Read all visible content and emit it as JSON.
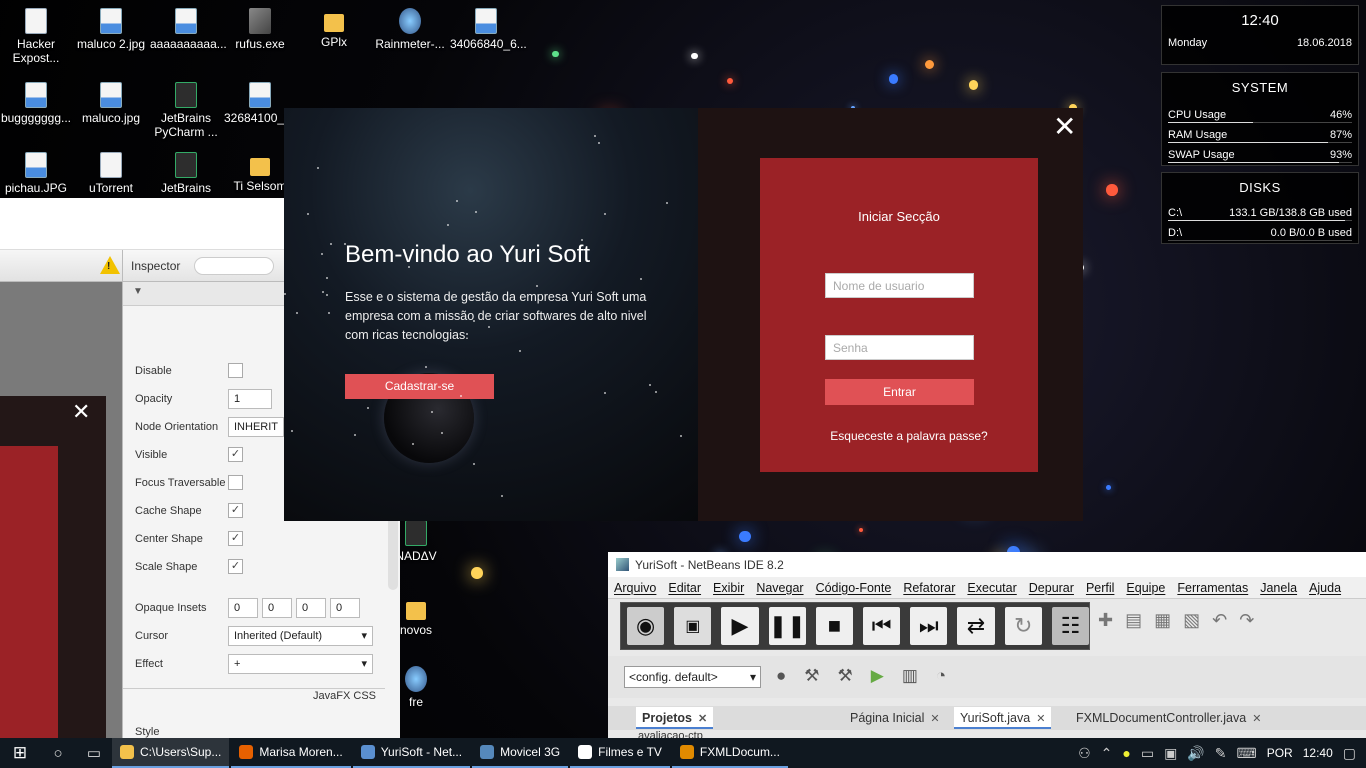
{
  "desktop": {
    "icons": [
      {
        "label": "Hacker Expost...",
        "icon": "pdf-file-icon"
      },
      {
        "label": "maluco 2.jpg",
        "icon": "image-file-icon"
      },
      {
        "label": "aaaaaaaaaa...",
        "icon": "image-file-icon"
      },
      {
        "label": "rufus.exe",
        "icon": "usb-drive-icon"
      },
      {
        "label": "GPlx",
        "icon": "folder-icon"
      },
      {
        "label": "Rainmeter-...",
        "icon": "rainmeter-icon"
      },
      {
        "label": "34066840_6...",
        "icon": "image-file-icon"
      },
      {
        "label": "buggggggg...",
        "icon": "image-file-icon"
      },
      {
        "label": "maluco.jpg",
        "icon": "image-file-icon"
      },
      {
        "label": "JetBrains PyCharm ...",
        "icon": "pycharm-icon"
      },
      {
        "label": "32684100_1...",
        "icon": "image-file-icon"
      },
      {
        "label": "pichau.JPG",
        "icon": "image-file-icon"
      },
      {
        "label": "uTorrent",
        "icon": "file-icon"
      },
      {
        "label": "JetBrains",
        "icon": "pycharm-icon"
      },
      {
        "label": "Ti Selsom",
        "icon": "folder-icon"
      },
      {
        "label": "NADΔV",
        "icon": "app-icon"
      },
      {
        "label": "novos",
        "icon": "folder-icon"
      },
      {
        "label": "fre",
        "icon": "firefox-icon"
      }
    ]
  },
  "widgets": {
    "clock": {
      "time": "12:40",
      "day": "Monday",
      "date": "18.06.2018"
    },
    "system": {
      "title": "SYSTEM",
      "rows": [
        {
          "label": "CPU Usage",
          "value": "46%",
          "fill": 0.46
        },
        {
          "label": "RAM Usage",
          "value": "87%",
          "fill": 0.87
        },
        {
          "label": "SWAP Usage",
          "value": "93%",
          "fill": 0.93
        }
      ]
    },
    "disks": {
      "title": "DISKS",
      "rows": [
        {
          "label": "C:\\",
          "value": "133.1 GB/138.8 GB used",
          "fill": 0.96
        },
        {
          "label": "D:\\",
          "value": "0.0 B/0.0 B used",
          "fill": 0.0
        }
      ]
    }
  },
  "scene_builder": {
    "inspector_label": "Inspector",
    "warning_symbol": "!",
    "properties": [
      {
        "label": "Disable",
        "type": "checkbox",
        "checked": false
      },
      {
        "label": "Opacity",
        "type": "field",
        "value": "1"
      },
      {
        "label": "Node Orientation",
        "type": "field",
        "value": "INHERIT"
      },
      {
        "label": "Visible",
        "type": "checkbox",
        "checked": true
      },
      {
        "label": "Focus Traversable",
        "type": "checkbox",
        "checked": false
      },
      {
        "label": "Cache Shape",
        "type": "checkbox",
        "checked": true
      },
      {
        "label": "Center Shape",
        "type": "checkbox",
        "checked": true
      },
      {
        "label": "Scale Shape",
        "type": "checkbox",
        "checked": true
      },
      {
        "label": "Opaque Insets",
        "type": "insets",
        "values": [
          "0",
          "0",
          "0",
          "0"
        ]
      },
      {
        "label": "Cursor",
        "type": "select",
        "value": "Inherited (Default)"
      },
      {
        "label": "Effect",
        "type": "select",
        "value": "+"
      }
    ],
    "css_label": "JavaFX CSS",
    "style_label": "Style"
  },
  "login_dialog": {
    "welcome_title": "Bem-vindo ao Yuri Soft",
    "description": "Esse e o sistema de gestão da empresa Yuri Soft uma empresa com a missão de criar softwares de alto nivel com ricas tecnologias.",
    "signup_label": "Cadastrar-se",
    "close_symbol": "✕",
    "login_title": "Iniciar Secção",
    "username_placeholder": "Nome de usuario",
    "password_placeholder": "Senha",
    "login_button": "Entrar",
    "forgot_link": "Esqueceste a palavra passe?"
  },
  "netbeans": {
    "title": "YuriSoft - NetBeans IDE 8.2",
    "menu": [
      "Arquivo",
      "Editar",
      "Exibir",
      "Navegar",
      "Código-Fonte",
      "Refatorar",
      "Executar",
      "Depurar",
      "Perfil",
      "Equipe",
      "Ferramentas",
      "Janela",
      "Ajuda"
    ],
    "config": "<config. default>",
    "projects_tab": "Projetos",
    "project_item": "avaliacao-ctp",
    "editor_tabs": [
      "Página Inicial",
      "YuriSoft.java",
      "FXMLDocumentController.java"
    ]
  },
  "taskbar": {
    "apps": [
      {
        "label": "C:\\Users\\Sup...",
        "color": "#f3c14b"
      },
      {
        "label": "Marisa Moren...",
        "color": "#e66000"
      },
      {
        "label": "YuriSoft - Net...",
        "color": "#5a8fd0"
      },
      {
        "label": "Movicel 3G",
        "color": "#58b"
      },
      {
        "label": "Filmes e TV",
        "color": "#fff"
      },
      {
        "label": "FXMLDocum...",
        "color": "#e08a00"
      }
    ],
    "language": "POR",
    "time": "12:40"
  },
  "colors": {
    "dialog_red": "#9b2226",
    "button_red": "#e05155",
    "dialog_dark": "#1e1212"
  }
}
